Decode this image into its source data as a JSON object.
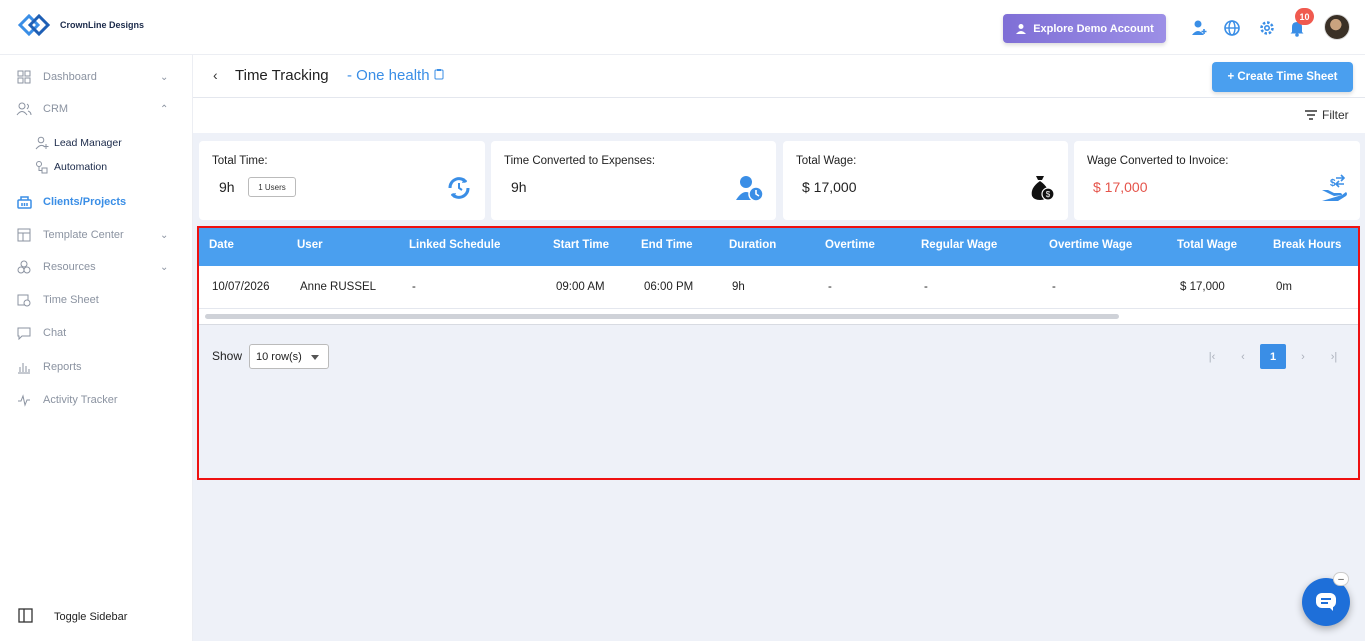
{
  "app": {
    "name": "CrownLine Designs"
  },
  "header": {
    "demo_button": "Explore Demo Account",
    "notification_count": "10"
  },
  "sidebar": {
    "items": [
      {
        "label": "Dashboard",
        "icon": "grid-icon",
        "chevron": "down"
      },
      {
        "label": "CRM",
        "icon": "users-icon",
        "chevron": "up"
      },
      {
        "label": "Lead Manager",
        "icon": "user-plus-icon",
        "sub": true
      },
      {
        "label": "Automation",
        "icon": "automation-icon",
        "sub": true
      },
      {
        "label": "Clients/Projects",
        "icon": "building-icon",
        "active": true
      },
      {
        "label": "Template Center",
        "icon": "template-icon",
        "chevron": "down"
      },
      {
        "label": "Resources",
        "icon": "resources-icon",
        "chevron": "down"
      },
      {
        "label": "Time Sheet",
        "icon": "calendar-clock-icon"
      },
      {
        "label": "Chat",
        "icon": "chat-icon"
      },
      {
        "label": "Reports",
        "icon": "bar-chart-icon"
      },
      {
        "label": "Activity Tracker",
        "icon": "activity-icon"
      }
    ],
    "toggle_label": "Toggle Sidebar"
  },
  "page": {
    "title": "Time Tracking",
    "subtitle": "- One health",
    "create_button": "+ Create Time Sheet",
    "filter_label": "Filter"
  },
  "cards": [
    {
      "label": "Total Time:",
      "value": "9h",
      "chip": "1 Users"
    },
    {
      "label": "Time Converted to Expenses:",
      "value": "9h"
    },
    {
      "label": "Total Wage:",
      "value": "$ 17,000"
    },
    {
      "label": "Wage Converted to Invoice:",
      "value": "$ 17,000"
    }
  ],
  "table": {
    "columns": [
      "Date",
      "User",
      "Linked Schedule",
      "Start Time",
      "End Time",
      "Duration",
      "Overtime",
      "Regular Wage",
      "Overtime Wage",
      "Total Wage",
      "Break Hours"
    ],
    "rows": [
      [
        "10/07/2026",
        "Anne RUSSEL",
        "-",
        "09:00 AM",
        "06:00 PM",
        "9h",
        "-",
        "-",
        "-",
        "$ 17,000",
        "0m"
      ]
    ]
  },
  "pagination": {
    "show_label": "Show",
    "rows_per_page": "10 row(s)",
    "current_page": "1"
  },
  "colors": {
    "accent": "#4a9fef",
    "highlight_border": "#ee1111",
    "wage_red": "#e5544b"
  }
}
